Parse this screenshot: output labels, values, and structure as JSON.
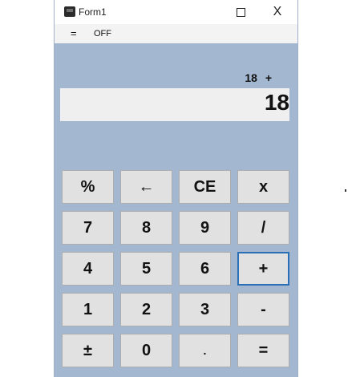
{
  "window": {
    "title": "Form1",
    "maximize_icon": "maximize-icon",
    "close_label": "X"
  },
  "menu": {
    "menu_icon": "=",
    "off_label": "OFF"
  },
  "display": {
    "expression": "18 +",
    "value": "18"
  },
  "keys": [
    {
      "label": "%",
      "name": "percent-button"
    },
    {
      "label": "←",
      "name": "backspace-button"
    },
    {
      "label": "CE",
      "name": "clear-entry-button"
    },
    {
      "label": "x",
      "name": "multiply-button"
    },
    {
      "label": "7",
      "name": "digit-7-button"
    },
    {
      "label": "8",
      "name": "digit-8-button"
    },
    {
      "label": "9",
      "name": "digit-9-button"
    },
    {
      "label": "/",
      "name": "divide-button"
    },
    {
      "label": "4",
      "name": "digit-4-button"
    },
    {
      "label": "5",
      "name": "digit-5-button"
    },
    {
      "label": "6",
      "name": "digit-6-button"
    },
    {
      "label": "+",
      "name": "add-button"
    },
    {
      "label": "1",
      "name": "digit-1-button"
    },
    {
      "label": "2",
      "name": "digit-2-button"
    },
    {
      "label": "3",
      "name": "digit-3-button"
    },
    {
      "label": "-",
      "name": "subtract-button"
    },
    {
      "label": "±",
      "name": "negate-button"
    },
    {
      "label": "0",
      "name": "digit-0-button"
    },
    {
      "label": ".",
      "name": "decimal-button"
    },
    {
      "label": "=",
      "name": "equals-button"
    }
  ],
  "focused_key": "+",
  "colors": {
    "window_background": "#a3b7d1",
    "key_background": "#e1e1e1",
    "focus_border": "#2b6fb6"
  }
}
